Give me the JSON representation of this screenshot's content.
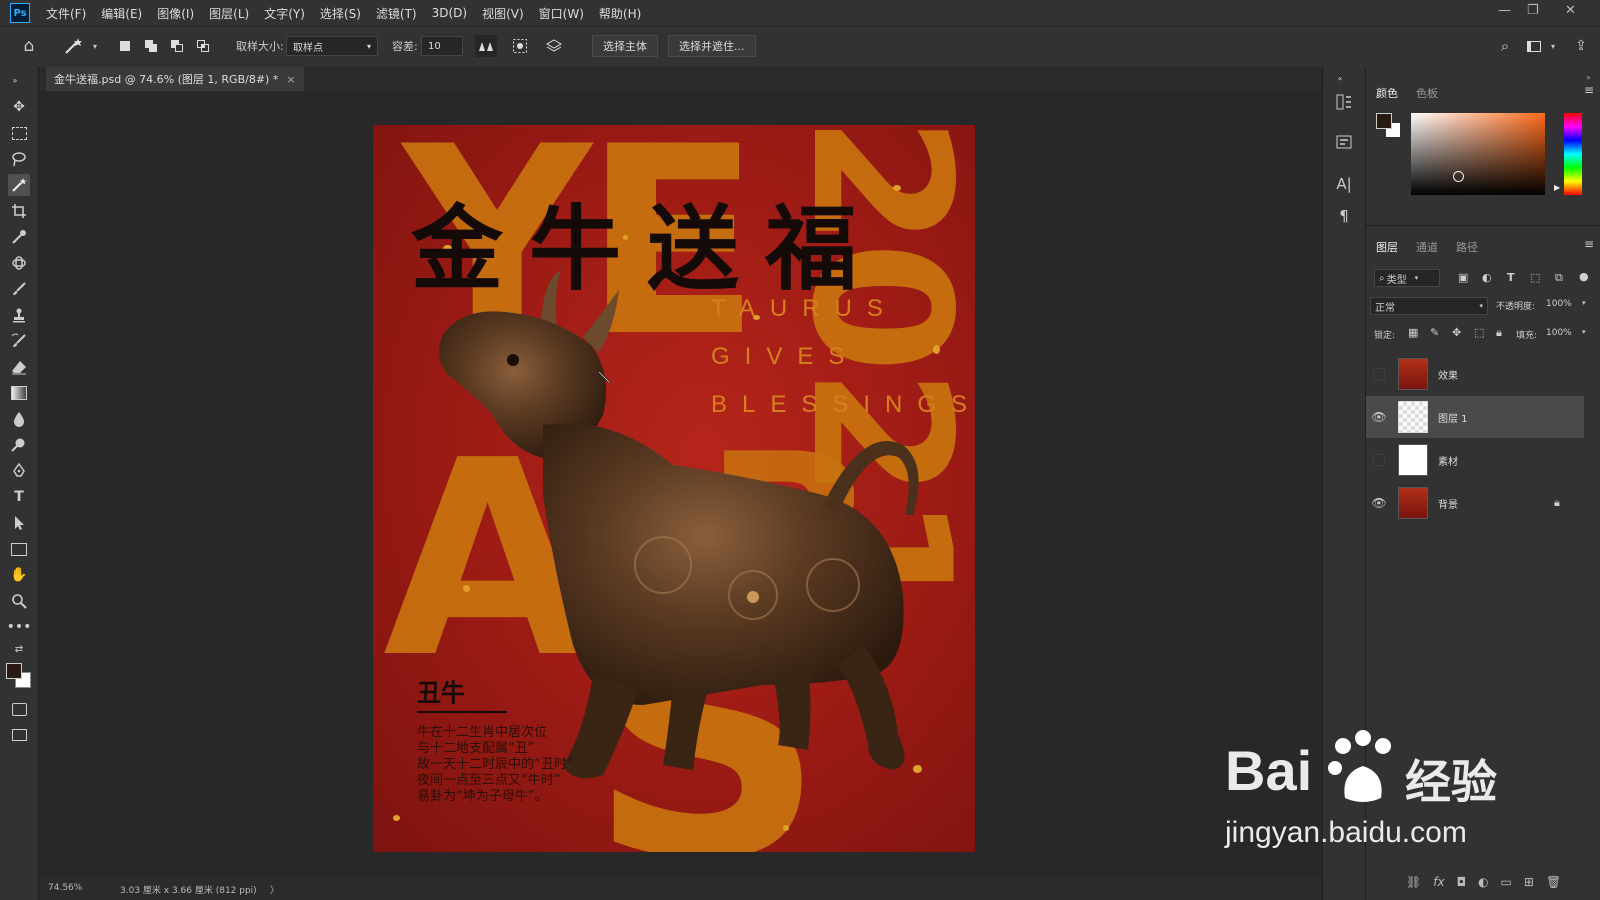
{
  "app": {
    "logo": "Ps"
  },
  "menu": [
    "文件(F)",
    "编辑(E)",
    "图像(I)",
    "图层(L)",
    "文字(Y)",
    "选择(S)",
    "滤镜(T)",
    "3D(D)",
    "视图(V)",
    "窗口(W)",
    "帮助(H)"
  ],
  "options": {
    "sample_size_label": "取样大小:",
    "sample_size_value": "取样点",
    "tolerance_label": "容差:",
    "tolerance_value": "10",
    "select_subject": "选择主体",
    "select_and_mask": "选择并遮住..."
  },
  "document": {
    "tab_title": "金牛送福.psd @ 74.6% (图层 1, RGB/8#) *",
    "close": "×"
  },
  "poster": {
    "title_cn": "金牛送福",
    "en_lines": [
      "TAURUS",
      "GIVES",
      "BLESSINGS"
    ],
    "zodiac": "丑牛",
    "description": [
      "牛在十二生肖中居次位",
      "与十二地支配属“丑”",
      "故一天十二时辰中的“丑时”",
      "夜间一点至三点又“牛时”",
      "易卦为“坤为子母牛”。"
    ]
  },
  "status": {
    "zoom": "74.56%",
    "doc_size": "3.03 厘米 x 3.66 厘米 (812 ppi)",
    "arrow": "〉"
  },
  "color_panel": {
    "tabs": [
      "颜色",
      "色板"
    ]
  },
  "layers_panel": {
    "tabs": [
      "图层",
      "通道",
      "路径"
    ],
    "filter": "类型",
    "blend_mode": "正常",
    "opacity_label": "不透明度:",
    "opacity_value": "100%",
    "lock_label": "锁定:",
    "fill_label": "填充:",
    "fill_value": "100%",
    "layers": [
      {
        "name": "效果",
        "visible": false,
        "selected": false,
        "locked": false
      },
      {
        "name": "图层 1",
        "visible": true,
        "selected": true,
        "locked": false
      },
      {
        "name": "素材",
        "visible": false,
        "selected": false,
        "locked": false
      },
      {
        "name": "背景",
        "visible": true,
        "selected": false,
        "locked": true
      }
    ]
  },
  "watermark": {
    "brand": "Bai",
    "brand2": "经验",
    "url": "jingyan.baidu.com"
  },
  "colors": {
    "accent": "#31a8ff",
    "poster_red": "#9a1a14",
    "poster_gold": "#c9730f"
  }
}
